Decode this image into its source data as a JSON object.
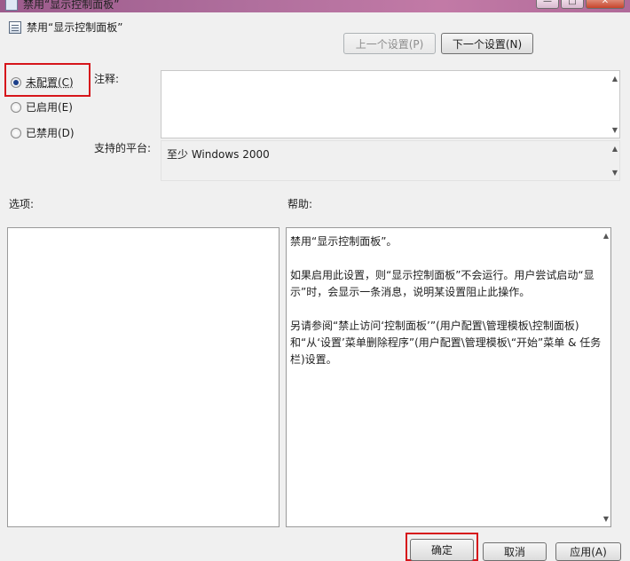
{
  "window": {
    "title": "禁用“显示控制面板”",
    "close_glyph": "✕",
    "minimize_glyph": "—",
    "maximize_glyph": "□"
  },
  "header": {
    "policy_name": "禁用“显示控制面板”"
  },
  "nav": {
    "prev_label": "上一个设置(P)",
    "next_label": "下一个设置(N)"
  },
  "state": {
    "options": [
      {
        "label": "未配置(C)",
        "selected": true
      },
      {
        "label": "已启用(E)",
        "selected": false
      },
      {
        "label": "已禁用(D)",
        "selected": false
      }
    ]
  },
  "comment": {
    "label": "注释:",
    "value": ""
  },
  "platform": {
    "label": "支持的平台:",
    "value": "至少 Windows 2000"
  },
  "options_panel": {
    "label": "选项:"
  },
  "help_panel": {
    "label": "帮助:",
    "paragraphs": [
      "禁用“显示控制面板”。",
      "如果启用此设置，则“显示控制面板”不会运行。用户尝试启动“显示”时，会显示一条消息，说明某设置阻止此操作。",
      "另请参阅“禁止访问‘控制面板’”(用户配置\\管理模板\\控制面板)和“从‘设置’菜单删除程序”(用户配置\\管理模板\\“开始”菜单 & 任务栏)设置。"
    ]
  },
  "footer": {
    "ok_label": "确定",
    "cancel_label": "取消",
    "apply_label": "应用(A)"
  },
  "colors": {
    "highlight": "#d6151b",
    "radio_dot": "#1c3f8a"
  }
}
